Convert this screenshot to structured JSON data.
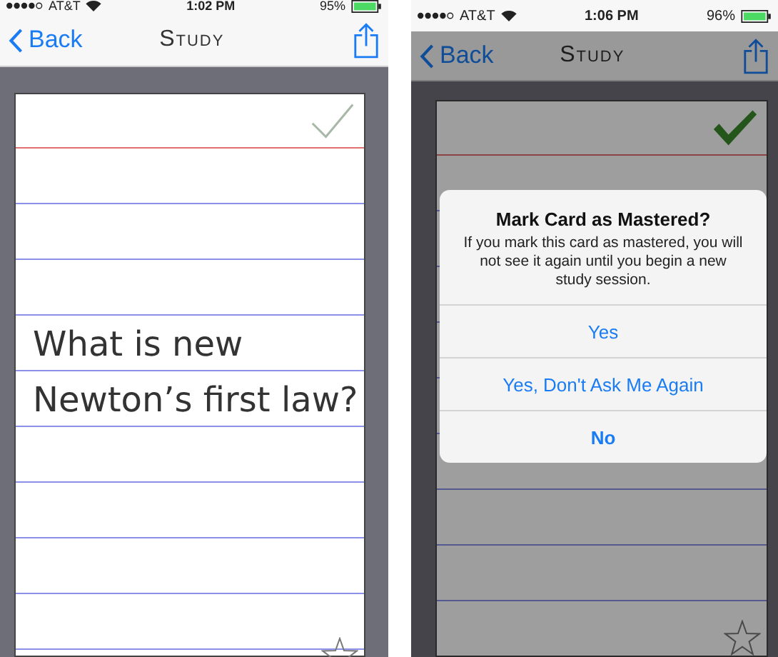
{
  "screens": [
    {
      "status_bar": {
        "carrier": "AT&T",
        "time": "1:02 PM",
        "battery": "95%"
      },
      "nav": {
        "back": "Back",
        "title": "Study"
      },
      "card": {
        "lines": [
          "What is new",
          "Newton’s first law?"
        ],
        "mastered": false
      },
      "dimmed": false
    },
    {
      "status_bar": {
        "carrier": "AT&T",
        "time": "1:06 PM",
        "battery": "96%"
      },
      "nav": {
        "back": "Back",
        "title": "Study"
      },
      "card": {
        "mastered": true
      },
      "dimmed": true,
      "alert": {
        "title": "Mark Card as Mastered?",
        "message": "If you mark this card as mastered, you will not see it again until you begin a new study session.",
        "buttons": [
          {
            "label": "Yes",
            "bold": false
          },
          {
            "label": "Yes, Don't Ask Me Again",
            "bold": false
          },
          {
            "label": "No",
            "bold": true
          }
        ]
      }
    }
  ]
}
